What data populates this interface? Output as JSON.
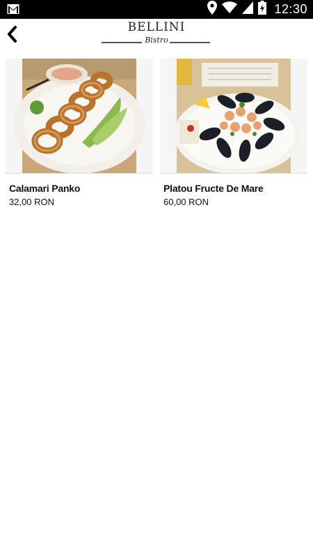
{
  "status_bar": {
    "time": "12:30",
    "icons": [
      "gmail-icon",
      "location-icon",
      "wifi-icon",
      "signal-icon",
      "battery-charging-icon"
    ]
  },
  "header": {
    "back_icon": "chevron-left-icon",
    "logo_text": "BELLINI",
    "logo_subtext": "Bistro"
  },
  "products": [
    {
      "name": "Calamari Panko",
      "price": "32,00 RON",
      "image": "fried-calamari-photo"
    },
    {
      "name": "Platou Fructe De Mare",
      "price": "60,00 RON",
      "image": "seafood-platter-photo"
    }
  ],
  "colors": {
    "status_bar_bg": "#000000",
    "background": "#ffffff",
    "card_image_bg": "#f5f5f5",
    "text": "#111111"
  }
}
